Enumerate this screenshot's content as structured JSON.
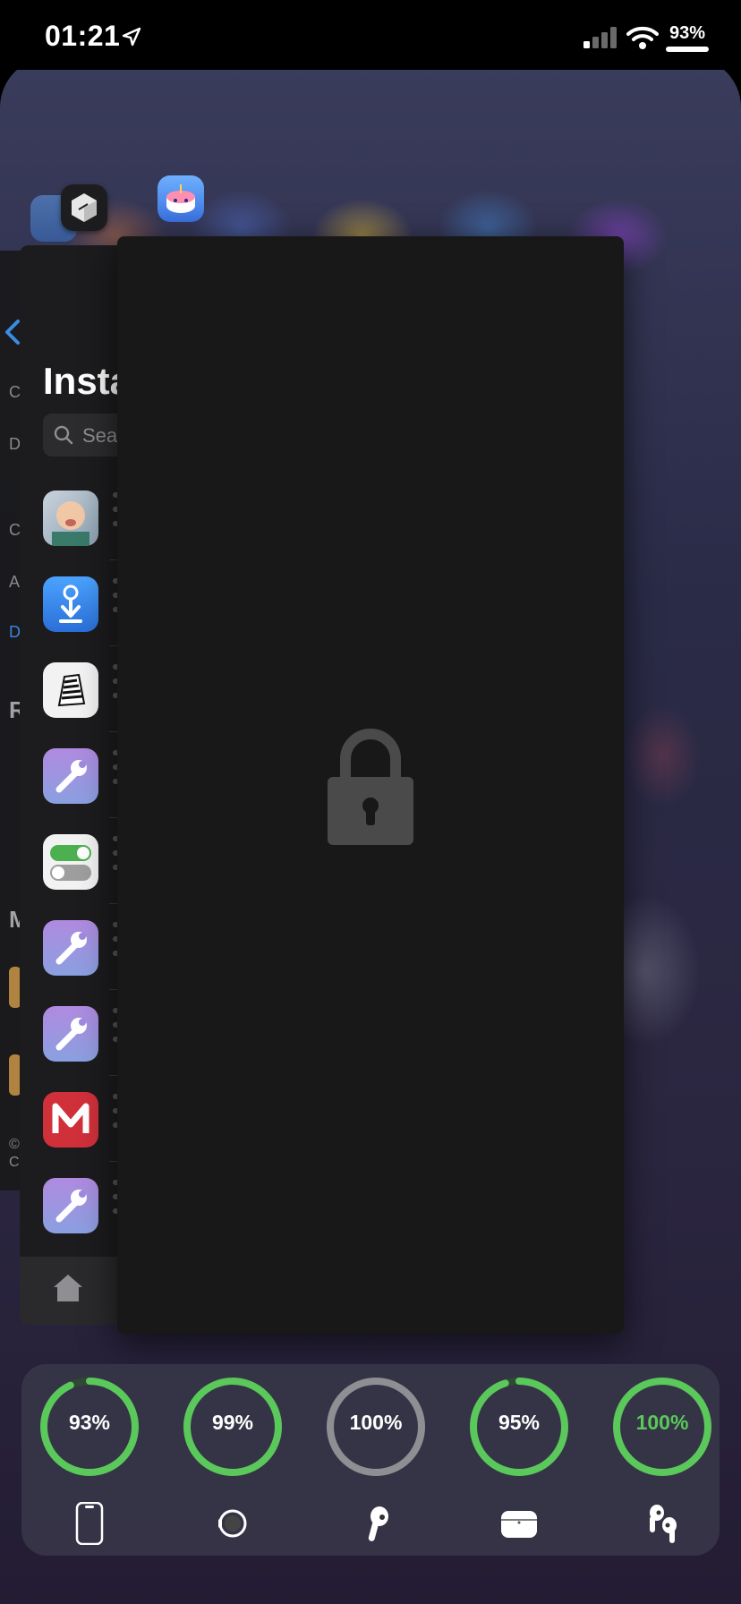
{
  "status_bar": {
    "time": "01:21",
    "battery_percent": "93%",
    "icons": [
      "location-arrow-icon",
      "cellular-signal-icon",
      "wifi-icon",
      "battery-icon"
    ]
  },
  "app_switcher": {
    "background_app_icons": [
      "installer-icon",
      "cube-app-icon",
      "cake-app-icon"
    ],
    "installed_card": {
      "title": "Insta",
      "search_placeholder": "Sear",
      "back_label_letters": [
        "C",
        "D",
        "C",
        "A",
        "D",
        "R",
        "M",
        "©",
        "C"
      ],
      "items": [
        {
          "icon": "baby-photo-icon"
        },
        {
          "icon": "installer-download-icon"
        },
        {
          "icon": "zebra-icon"
        },
        {
          "icon": "wrench-tweak-icon"
        },
        {
          "icon": "toggles-icon"
        },
        {
          "icon": "wrench-tweak-icon"
        },
        {
          "icon": "wrench-tweak-icon"
        },
        {
          "icon": "m-app-icon"
        },
        {
          "icon": "wrench-tweak-icon"
        }
      ],
      "tab_icon": "home-icon"
    },
    "locked_card": {
      "icon": "lock-icon"
    }
  },
  "battery_widget": {
    "devices": [
      {
        "label": "93%",
        "level": 0.93,
        "color": "#5ac85a",
        "icon": "iphone-icon"
      },
      {
        "label": "99%",
        "level": 0.99,
        "color": "#5ac85a",
        "icon": "watch-icon"
      },
      {
        "label": "100%",
        "level": 1.0,
        "color": "#8e8e93",
        "icon": "airpod-single-icon"
      },
      {
        "label": "95%",
        "level": 0.95,
        "color": "#5ac85a",
        "icon": "airpods-case-icon"
      },
      {
        "label": "100%",
        "level": 1.0,
        "color": "#5ac85a",
        "icon": "airpods-pair-icon",
        "label_green": true
      }
    ]
  }
}
